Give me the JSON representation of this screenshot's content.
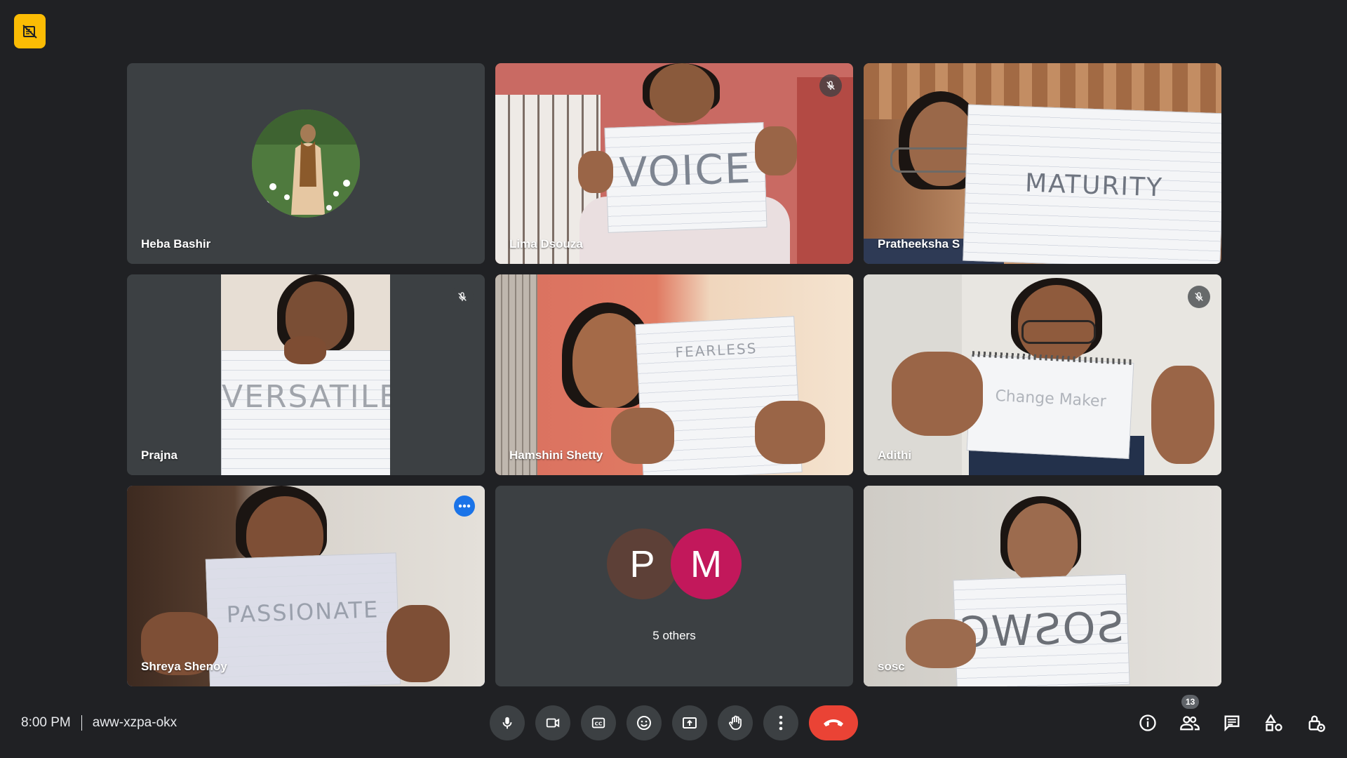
{
  "meeting": {
    "time": "8:00 PM",
    "code": "aww-xzpa-okx"
  },
  "participants": [
    {
      "name": "Heba Bashir"
    },
    {
      "name": "Lima Dsouza",
      "paper_text": "VOICE"
    },
    {
      "name": "Pratheeksha S",
      "paper_text": "MATURITY"
    },
    {
      "name": "Prajna",
      "paper_text": "VERSATILE"
    },
    {
      "name": "Hamshini Shetty",
      "paper_text": "FEARLESS"
    },
    {
      "name": "Adithi",
      "paper_text": "Change Maker"
    },
    {
      "name": "Shreya Shenoy",
      "paper_text": "PASSIONATE"
    },
    {
      "name": "sosc",
      "paper_text": "SOSWC"
    }
  ],
  "others_tile": {
    "avatars": [
      {
        "letter": "P",
        "color": "#5d4037"
      },
      {
        "letter": "M",
        "color": "#c2185b"
      }
    ],
    "label": "5 others"
  },
  "toolbar": {
    "participant_count": "13"
  },
  "colors": {
    "background": "#202124",
    "tile": "#3c4043",
    "end_call": "#ea4335",
    "active_border": "#8ab4f8",
    "badge": "#fbbc04"
  },
  "icons": [
    "no-video-badge-icon",
    "mic-off-icon",
    "more-options-icon",
    "microphone-icon",
    "camera-icon",
    "captions-icon",
    "emoji-icon",
    "present-icon",
    "raise-hand-icon",
    "more-vert-icon",
    "end-call-icon",
    "info-icon",
    "people-icon",
    "chat-icon",
    "activities-icon",
    "host-controls-icon"
  ]
}
